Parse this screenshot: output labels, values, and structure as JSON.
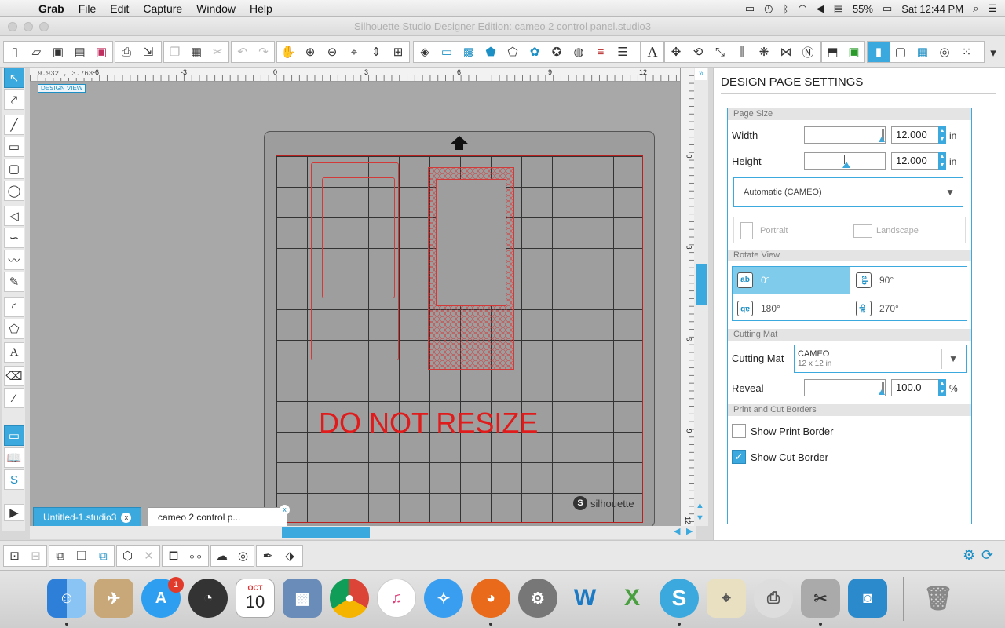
{
  "menubar": {
    "app": "Grab",
    "items": [
      "File",
      "Edit",
      "Capture",
      "Window",
      "Help"
    ],
    "battery": "55%",
    "clock": "Sat 12:44 PM"
  },
  "window": {
    "title": "Silhouette Studio Designer Edition: cameo 2 control panel.studio3"
  },
  "canvas": {
    "coords": "9.932 , 3.763",
    "design_view": "DESIGN VIEW",
    "warning_text": "DO NOT RESIZE",
    "brand": "silhouette",
    "hruler_labels": [
      "-6",
      "-3",
      "0",
      "3",
      "6",
      "9",
      "12"
    ],
    "vruler_labels": [
      "0",
      "3",
      "6",
      "9",
      "12"
    ]
  },
  "tabs": [
    {
      "label": "Untitled-1.studio3",
      "close": "x"
    },
    {
      "label": "cameo 2 control p...",
      "close": "x"
    }
  ],
  "panel": {
    "title": "DESIGN PAGE SETTINGS",
    "page_size": {
      "section": "Page Size",
      "width_label": "Width",
      "width_value": "12.000",
      "height_label": "Height",
      "height_value": "12.000",
      "unit": "in",
      "preset": "Automatic (CAMEO)",
      "portrait": "Portrait",
      "landscape": "Landscape"
    },
    "rotate": {
      "section": "Rotate View",
      "options": [
        "0°",
        "90°",
        "180°",
        "270°"
      ],
      "selected": "0°"
    },
    "cutting_mat": {
      "section": "Cutting Mat",
      "label": "Cutting Mat",
      "value": "CAMEO",
      "sub": "12 x 12 in",
      "reveal_label": "Reveal",
      "reveal_value": "100.0",
      "reveal_unit": "%"
    },
    "borders": {
      "section": "Print and Cut Borders",
      "print_label": "Show Print Border",
      "print_checked": false,
      "cut_label": "Show Cut Border",
      "cut_checked": true
    }
  },
  "dock": {
    "calendar_month": "OCT",
    "calendar_day": "10",
    "appstore_badge": "1"
  },
  "colors": {
    "accent": "#3ba9dd",
    "cut_line": "#d23a3a",
    "warning": "#e01b1b"
  }
}
